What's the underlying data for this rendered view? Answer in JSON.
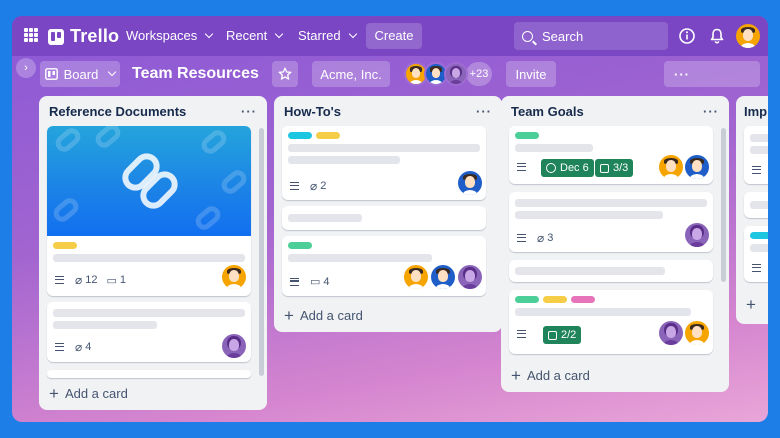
{
  "app": {
    "name": "Trello"
  },
  "nav": {
    "workspaces": "Workspaces",
    "recent": "Recent",
    "starred": "Starred",
    "create": "Create"
  },
  "search": {
    "placeholder": "Search"
  },
  "board": {
    "view": "Board",
    "title": "Team Resources",
    "workspace": "Acme, Inc.",
    "members_more": "+23",
    "invite": "Invite",
    "more": "···"
  },
  "colors": {
    "green": "#4bce97",
    "yellow": "#f5cd47",
    "cyan": "#1dc6e0",
    "pink": "#e774bb",
    "badge_green": "#1f845a"
  },
  "lists": [
    {
      "title": "Reference Documents",
      "add": "Add a card",
      "cards": [
        {
          "labels": [
            "yellow"
          ],
          "attachments": "12",
          "comments": "1",
          "avatar": "yellow",
          "cover": true
        },
        {
          "attachments": "4",
          "avatar": "purple"
        }
      ]
    },
    {
      "title": "How-To's",
      "add": "Add a card",
      "cards": [
        {
          "labels": [
            "cyan",
            "yellow"
          ],
          "attachments": "2",
          "avatar": "blue"
        },
        {},
        {
          "labels": [
            "green"
          ],
          "comments": "4",
          "avatars": [
            "yellow",
            "blue",
            "purple"
          ]
        }
      ]
    },
    {
      "title": "Team Goals",
      "add": "Add a card",
      "cards": [
        {
          "labels": [
            "green"
          ],
          "due": "Dec 6",
          "checklist": "3/3",
          "avatars": [
            "yellow",
            "blue"
          ]
        },
        {
          "attachments": "3",
          "avatar": "purple"
        },
        {},
        {
          "labels": [
            "green",
            "yellow",
            "pink"
          ],
          "checklist": "2/2",
          "avatars": [
            "purple",
            "yellow"
          ]
        }
      ]
    },
    {
      "title": "Imp",
      "add": "+"
    }
  ]
}
